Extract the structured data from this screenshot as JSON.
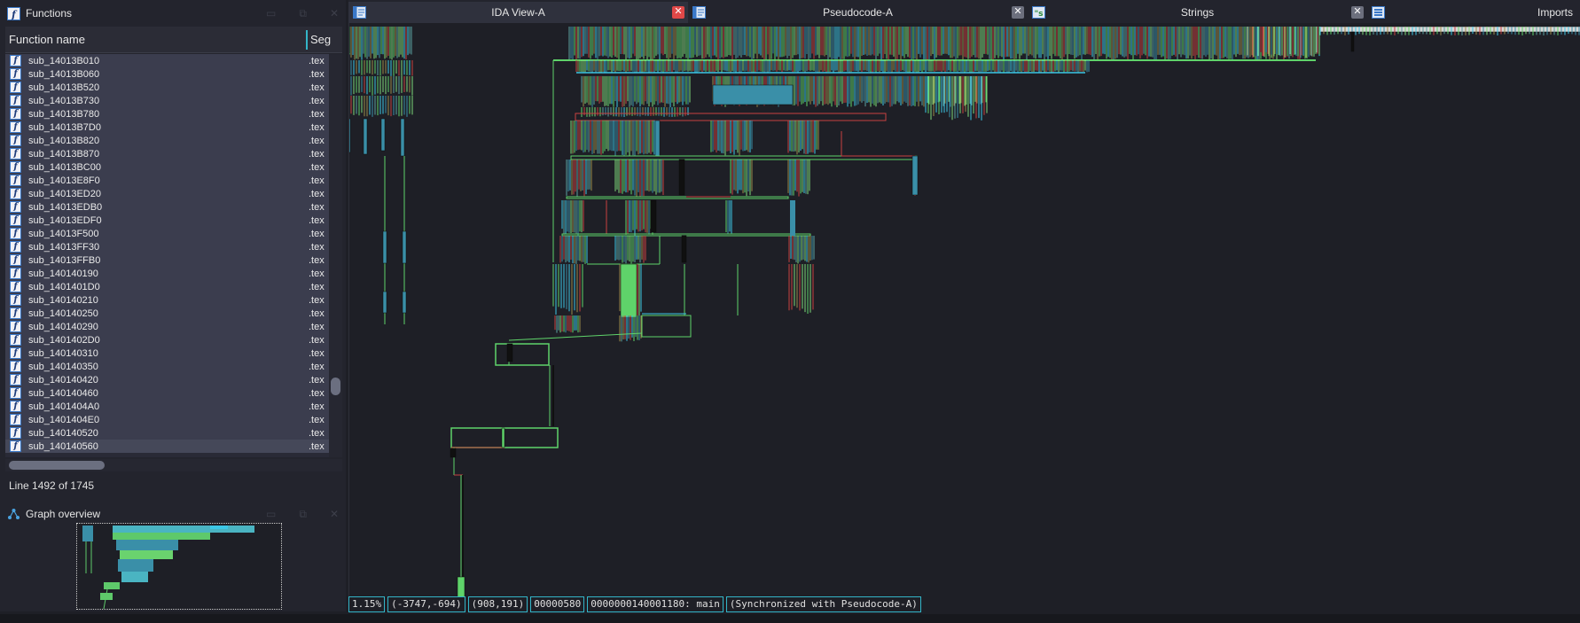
{
  "functions_panel": {
    "title": "Functions",
    "columns": {
      "name": "Function name",
      "segment": "Seg"
    },
    "rows": [
      {
        "name": "sub_14013B010",
        "segment": ".tex"
      },
      {
        "name": "sub_14013B060",
        "segment": ".tex"
      },
      {
        "name": "sub_14013B520",
        "segment": ".tex"
      },
      {
        "name": "sub_14013B730",
        "segment": ".tex"
      },
      {
        "name": "sub_14013B780",
        "segment": ".tex"
      },
      {
        "name": "sub_14013B7D0",
        "segment": ".tex"
      },
      {
        "name": "sub_14013B820",
        "segment": ".tex"
      },
      {
        "name": "sub_14013B870",
        "segment": ".tex"
      },
      {
        "name": "sub_14013BC00",
        "segment": ".tex"
      },
      {
        "name": "sub_14013E8F0",
        "segment": ".tex"
      },
      {
        "name": "sub_14013ED20",
        "segment": ".tex"
      },
      {
        "name": "sub_14013EDB0",
        "segment": ".tex"
      },
      {
        "name": "sub_14013EDF0",
        "segment": ".tex"
      },
      {
        "name": "sub_14013F500",
        "segment": ".tex"
      },
      {
        "name": "sub_14013FF30",
        "segment": ".tex"
      },
      {
        "name": "sub_14013FFB0",
        "segment": ".tex"
      },
      {
        "name": "sub_140140190",
        "segment": ".tex"
      },
      {
        "name": "sub_1401401D0",
        "segment": ".tex"
      },
      {
        "name": "sub_140140210",
        "segment": ".tex"
      },
      {
        "name": "sub_140140250",
        "segment": ".tex"
      },
      {
        "name": "sub_140140290",
        "segment": ".tex"
      },
      {
        "name": "sub_1401402D0",
        "segment": ".tex"
      },
      {
        "name": "sub_140140310",
        "segment": ".tex"
      },
      {
        "name": "sub_140140350",
        "segment": ".tex"
      },
      {
        "name": "sub_140140420",
        "segment": ".tex"
      },
      {
        "name": "sub_140140460",
        "segment": ".tex"
      },
      {
        "name": "sub_1401404A0",
        "segment": ".tex"
      },
      {
        "name": "sub_1401404E0",
        "segment": ".tex"
      },
      {
        "name": "sub_140140520",
        "segment": ".tex"
      },
      {
        "name": "sub_140140560",
        "segment": ".tex"
      }
    ],
    "selected_index": 29,
    "line_status": "Line 1492 of 1745"
  },
  "graph_overview": {
    "title": "Graph overview"
  },
  "tabs": [
    {
      "label": "IDA View-A",
      "active": true,
      "close_color": "#e04848"
    },
    {
      "label": "Pseudocode-A",
      "active": false,
      "close_color": "#6c6f7d"
    },
    {
      "label": "Strings",
      "active": false,
      "close_color": "#6c6f7d"
    },
    {
      "label": "Imports",
      "active": false
    }
  ],
  "status_bar": {
    "zoom": "1.15%",
    "graph_coords": "(-3747,-694)",
    "mouse_coords": "(908,191)",
    "offset": "00000580",
    "address": "0000000140001180: main",
    "sync": "(Synchronized with Pseudocode-A)"
  },
  "colors": {
    "accent": "#33b5c8",
    "edge_green": "#5fd36a",
    "edge_red": "#c84040",
    "edge_cyan": "#3cc7e6",
    "background": "#1e1f26"
  }
}
